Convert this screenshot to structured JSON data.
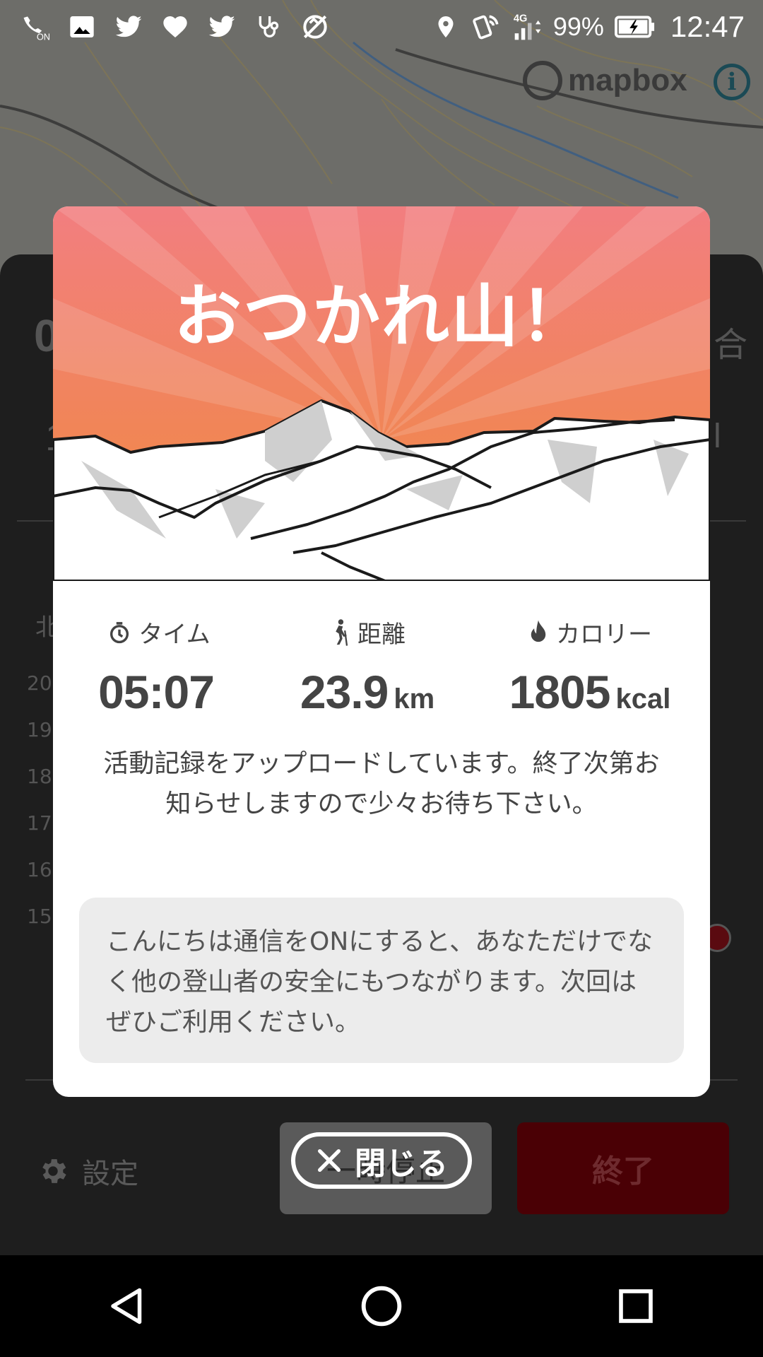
{
  "status_bar": {
    "left_icons": [
      "wifi-calling-on-icon",
      "gallery-icon",
      "twitter-icon",
      "heart-icon",
      "twitter-icon",
      "stethoscope-icon",
      "no-sync-icon"
    ],
    "right_icons": [
      "location-icon",
      "nfc-icon",
      "signal-4g-icon"
    ],
    "battery_percent": "99%",
    "time": "12:47"
  },
  "map": {
    "attribution": "mapbox",
    "info_label": "i"
  },
  "background": {
    "settings_label": "設定",
    "pause_label": "一時停止",
    "end_label": "終了",
    "chart_y_ticks": [
      "20",
      "19",
      "18",
      "17",
      "16",
      "15"
    ],
    "partial_left_text": "北"
  },
  "modal": {
    "title": "おつかれ山！",
    "stats": [
      {
        "icon": "stopwatch-icon",
        "label": "タイム",
        "value": "05:07",
        "unit": ""
      },
      {
        "icon": "hiker-icon",
        "label": "距離",
        "value": "23.9",
        "unit": "km"
      },
      {
        "icon": "flame-icon",
        "label": "カロリー",
        "value": "1805",
        "unit": "kcal"
      }
    ],
    "upload_message": "活動記録をアップロードしています。終了次第お知らせしますので少々お待ち下さい。",
    "info_message": "こんにちは通信をONにすると、あなただけでなく他の登山者の安全にもつながります。次回はぜひご利用ください。",
    "close_label": "閉じる"
  },
  "colors": {
    "hero_top": "#f27e80",
    "hero_bottom": "#f08a3c",
    "end_button": "#4a0005",
    "info_box": "#ececec"
  },
  "nav": {
    "back": "back-icon",
    "home": "home-icon",
    "recents": "recents-icon"
  }
}
